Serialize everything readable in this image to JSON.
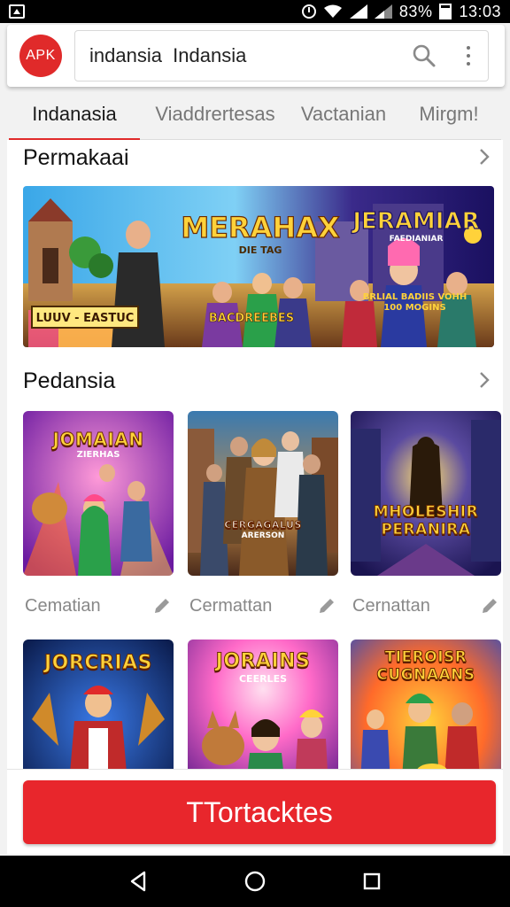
{
  "status_bar": {
    "battery": "83%",
    "time": "13:03",
    "icons": [
      "notification-icon",
      "alarm-icon",
      "wifi-icon",
      "signal-icon",
      "battery-icon"
    ]
  },
  "header": {
    "logo": "APK",
    "search_value": "indansia  Indansia",
    "icons": [
      "search-icon",
      "more-vert-icon"
    ]
  },
  "tabs": [
    {
      "label": "Indanasia",
      "active": true
    },
    {
      "label": "Viaddrertesas",
      "active": false
    },
    {
      "label": "Vactanian",
      "active": false
    },
    {
      "label": "Mirgm!",
      "active": false
    }
  ],
  "sections": [
    {
      "title": "Permakaai",
      "banner": {
        "title_left": "MERAHAX",
        "sub_left": "DIE TAG",
        "caption_left": "LUUV - EASTUC",
        "caption_mid": "BACDREEBES",
        "title_right": "JERAMIAR",
        "sub_right": "FAEDIANIAR",
        "caption_right": "BRLIAL BADIIS VOHH 100 MOGINS"
      }
    },
    {
      "title": "Pedansia",
      "cards": [
        {
          "label": "Cematian",
          "art_title": "JOMAIAN",
          "art_sub": "ZIERHAS"
        },
        {
          "label": "Cermattan",
          "art_title": "CERGAGALUS",
          "art_sub": "ARERSON"
        },
        {
          "label": "Cernattan",
          "art_title": "MHOLESHIR PERANIRA",
          "art_sub": ""
        },
        {
          "label": "",
          "art_title": "JORCRIAS",
          "art_sub": ""
        },
        {
          "label": "",
          "art_title": "JORAINS",
          "art_sub": "CEERLES"
        },
        {
          "label": "",
          "art_title": "TIEROISR CUGNAANS",
          "art_sub": ""
        }
      ]
    }
  ],
  "action_button": "TTortacktes",
  "nav_bar": [
    "back-icon",
    "home-icon",
    "recents-icon"
  ],
  "colors": {
    "accent": "#e02a2a",
    "button": "#e8262c",
    "background": "#f2f2f2",
    "status_bar": "#000000"
  }
}
